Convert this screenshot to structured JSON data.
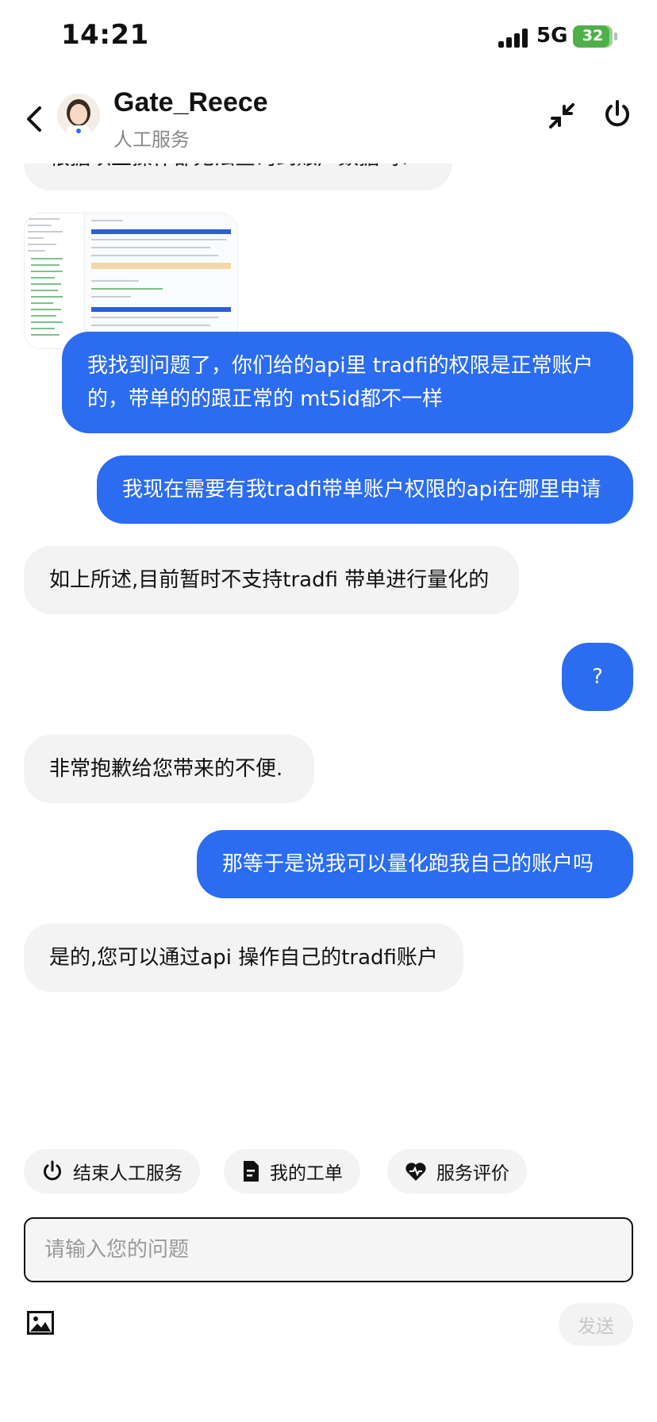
{
  "status_bar": {
    "time": "14:21",
    "network": "5G",
    "battery": "32"
  },
  "header": {
    "agent_name": "Gate_Reece",
    "agent_status": "人工服务"
  },
  "messages": {
    "cut_top": "根据以上操作都无法查询到账户数据吗?",
    "m1_line1": "我找到问题了，你们给的api里 tradfi的权限是正常账户",
    "m1_line2": "的，带单的的跟正常的 mt5id都不一样",
    "m2": "我现在需要有我tradfi带单账户权限的api在哪里申请",
    "m3": "如上所述,目前暂时不支持tradfi 带单进行量化的",
    "m4": "?",
    "m5": "非常抱歉给您带来的不便.",
    "m6": "那等于是说我可以量化跑我自己的账户吗",
    "m7": "是的,您可以通过api 操作自己的tradfi账户"
  },
  "quick_actions": {
    "end_service": "结束人工服务",
    "my_tickets": "我的工单",
    "rate_service": "服务评价"
  },
  "composer": {
    "placeholder": "请输入您的问题",
    "send_label": "发送"
  },
  "colors": {
    "user_bubble": "#2b6cf0",
    "agent_bubble": "#f3f3f3",
    "battery": "#4fb04a"
  }
}
